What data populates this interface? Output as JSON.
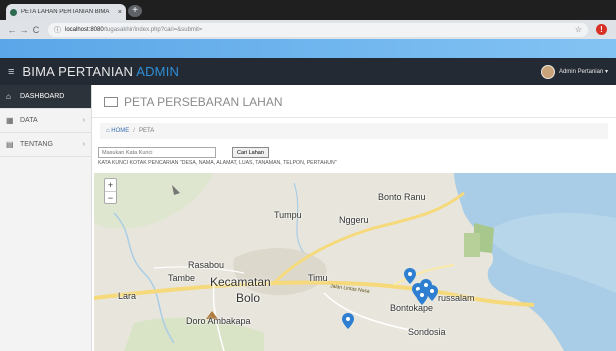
{
  "browser": {
    "tab_title": "PETA LAHAN PERTANIAN BIMA",
    "tab_close": "×",
    "new_tab": "+",
    "url_host": "localhost:8080",
    "url_path": "/tugasakhir/index.php?cari=&submit=",
    "nav_back": "←",
    "nav_forward": "→",
    "nav_reload": "C",
    "info_icon": "ⓘ",
    "star_icon": "☆",
    "extension": "!"
  },
  "header": {
    "brand_main": "BIMA PERTANIAN",
    "brand_accent": "ADMIN",
    "user": "Admin Pertanian ▾",
    "menu_icon": "≡"
  },
  "sidebar": {
    "items": [
      {
        "label": "DASHBOARD",
        "icon": "⌂",
        "chevron": ""
      },
      {
        "label": "DATA",
        "icon": "▦",
        "chevron": "›"
      },
      {
        "label": "TENTANG",
        "icon": "▤",
        "chevron": "›"
      }
    ]
  },
  "main": {
    "title": "PETA PERSEBARAN LAHAN",
    "breadcrumb": {
      "home": "HOME",
      "sep": "/",
      "current": "PETA"
    },
    "search": {
      "placeholder": "Masukan Kata Kunci",
      "button": "Cari Lahan",
      "hint": "KATA KUNCI KOTAK PENCARIAN \"DESA, NAMA, ALAMAT, LUAS, TANAMAN, TELPON, PERTAHUN\""
    }
  },
  "map": {
    "zoom_in": "+",
    "zoom_out": "−",
    "places": {
      "bonto_ranu": "Bonto Ranu",
      "tumpu": "Tumpu",
      "nggeru": "Nggeru",
      "rasabou": "Rasabou",
      "tambe": "Tambe",
      "kecamatan": "Kecamatan",
      "bolo": "Bolo",
      "timu": "Timu",
      "lara": "Lara",
      "doro_ambakapa": "Doro Ambakapa",
      "bontokape": "Bontokape",
      "russalam": "russalam",
      "sondosia": "Sondosia",
      "jalan_lintas": "Jalan Lintas Nusa"
    },
    "colors": {
      "water": "#a9cde6",
      "land": "#e8e6dc",
      "green": "#c9dcb4",
      "road": "#f5d97a",
      "pin": "#2e7fd1"
    }
  }
}
